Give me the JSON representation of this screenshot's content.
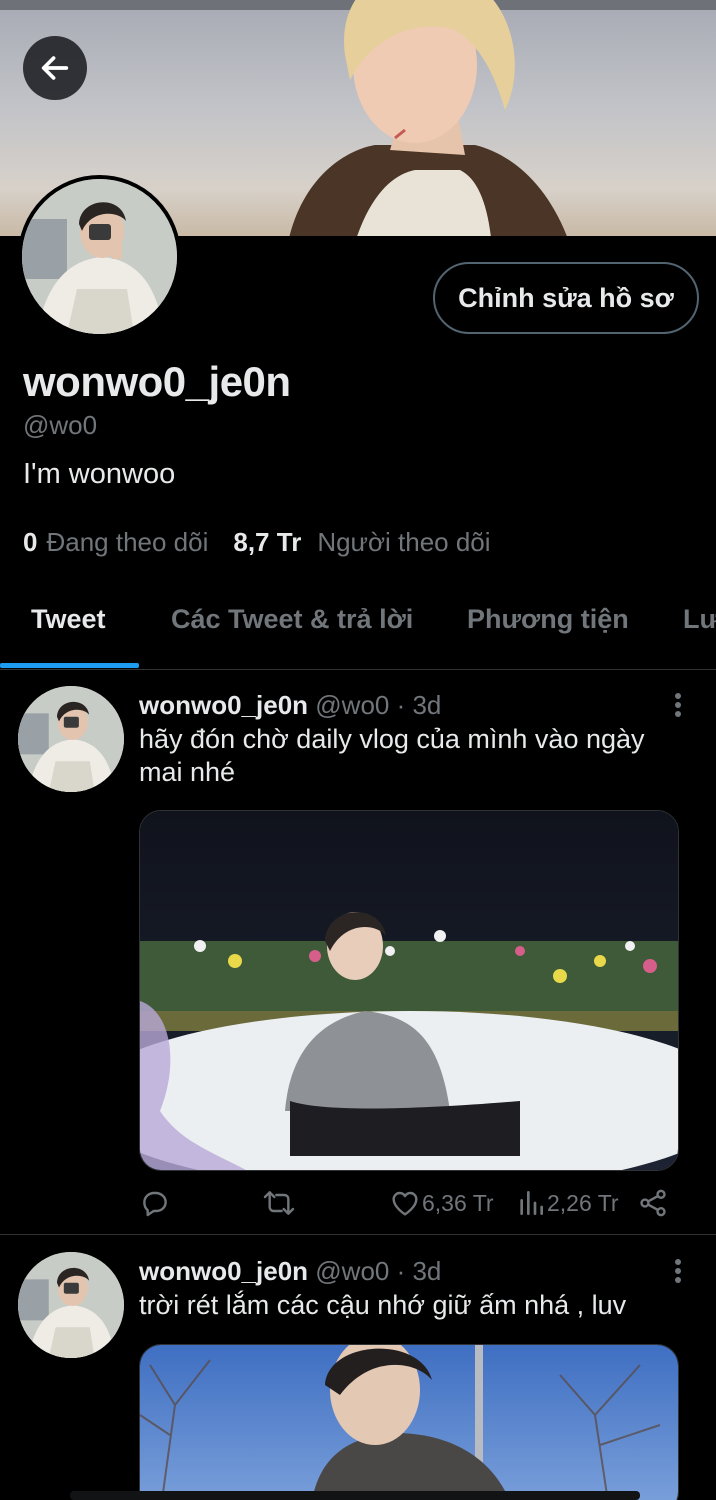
{
  "profile": {
    "display_name": "wonwo0_je0n",
    "handle": "@wo0",
    "bio": "I'm wonwoo",
    "following_count": "0",
    "following_label": "Đang theo dõi",
    "followers_count": "8,7 Tr",
    "followers_label": "Người theo dõi",
    "edit_button": "Chỉnh sửa hồ sơ"
  },
  "tabs": [
    {
      "label": "Tweet",
      "active": true
    },
    {
      "label": "Các Tweet & trả lời",
      "active": false
    },
    {
      "label": "Phương tiện",
      "active": false
    },
    {
      "label": "Lư",
      "active": false
    }
  ],
  "tweets": [
    {
      "name": "wonwo0_je0n",
      "meta": "@wo0 · 3d",
      "text": "hãy đón chờ daily vlog của mình vào ngày mai nhé",
      "likes": "6,36 Tr",
      "views": "2,26 Tr"
    },
    {
      "name": "wonwo0_je0n",
      "meta": "@wo0 · 3d",
      "text": "trời rét lắm các cậu nhớ giữ ấm nhá , luv"
    }
  ],
  "icons": {
    "back": "arrow-left-icon",
    "reply": "reply-icon",
    "retweet": "retweet-icon",
    "like": "heart-icon",
    "views": "views-icon",
    "share": "share-icon",
    "more": "more-vertical-icon"
  },
  "colors": {
    "accent": "#1d9bf0",
    "background": "#000000",
    "text_primary": "#e7e9ea",
    "text_secondary": "#71767b",
    "border": "#2f3336"
  }
}
